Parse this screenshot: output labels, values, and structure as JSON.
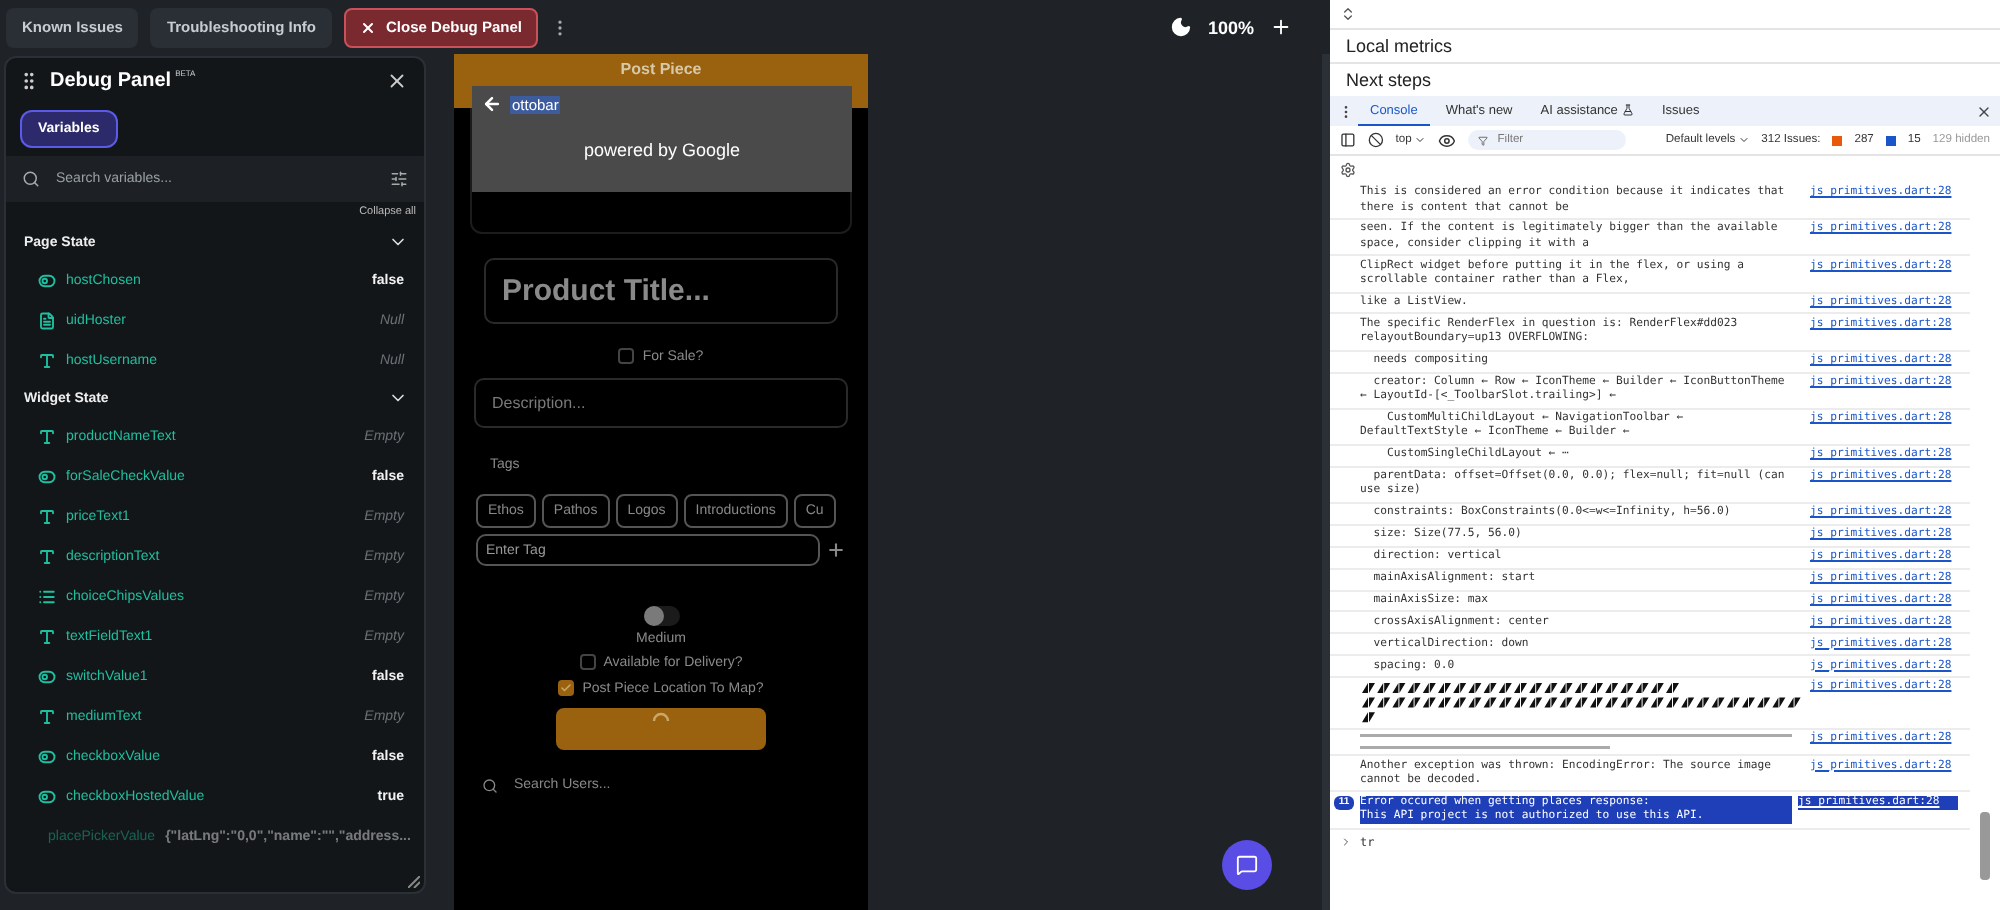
{
  "top_bar": {
    "buttons": [
      {
        "label": "Known Issues",
        "kind": "plain"
      },
      {
        "label": "Troubleshooting Info",
        "kind": "plain"
      },
      {
        "label": "Close Debug Panel",
        "kind": "danger"
      }
    ],
    "zoom": "100%"
  },
  "debug_panel": {
    "title": "Debug Panel",
    "badge": "BETA",
    "tabs": [
      {
        "label": "Variables",
        "selected": true
      }
    ],
    "search": {
      "placeholder": "Search variables..."
    },
    "collapse_all": "Collapse all",
    "sections": [
      {
        "title": "Page State",
        "expanded": true,
        "rows": [
          {
            "name": "hostChosen",
            "kind": "bool",
            "value": "false",
            "empty": false,
            "disabled": false
          },
          {
            "name": "uidHoster",
            "kind": "doc",
            "value": "Null",
            "empty": true,
            "disabled": false
          },
          {
            "name": "hostUsername",
            "kind": "text",
            "value": "Null",
            "empty": true,
            "disabled": false
          }
        ]
      },
      {
        "title": "Widget State",
        "expanded": true,
        "rows": [
          {
            "name": "productNameText",
            "kind": "text",
            "value": "Empty",
            "empty": true,
            "disabled": false
          },
          {
            "name": "forSaleCheckValue",
            "kind": "bool",
            "value": "false",
            "empty": false,
            "disabled": false
          },
          {
            "name": "priceText1",
            "kind": "text",
            "value": "Empty",
            "empty": true,
            "disabled": false
          },
          {
            "name": "descriptionText",
            "kind": "text",
            "value": "Empty",
            "empty": true,
            "disabled": false
          },
          {
            "name": "choiceChipsValues",
            "kind": "list",
            "value": "Empty",
            "empty": true,
            "disabled": false
          },
          {
            "name": "textFieldText1",
            "kind": "text",
            "value": "Empty",
            "empty": true,
            "disabled": false
          },
          {
            "name": "switchValue1",
            "kind": "bool",
            "value": "false",
            "empty": false,
            "disabled": false
          },
          {
            "name": "mediumText",
            "kind": "text",
            "value": "Empty",
            "empty": true,
            "disabled": false
          },
          {
            "name": "checkboxValue",
            "kind": "bool",
            "value": "false",
            "empty": false,
            "disabled": false
          },
          {
            "name": "checkboxHostedValue",
            "kind": "bool",
            "value": "true",
            "empty": false,
            "disabled": false
          },
          {
            "name": "placePickerValue",
            "kind": "place",
            "value": "{\"latLng\":\"0,0\",\"name\":\"\",\"address...",
            "empty": false,
            "disabled": true
          }
        ]
      }
    ]
  },
  "preview": {
    "title": "Post Piece",
    "place_search": {
      "value": "ottobar",
      "selected": true,
      "attribution": "powered by Google"
    },
    "product_title": {
      "placeholder": "Product Title..."
    },
    "for_sale": {
      "label": "For Sale?",
      "checked": false
    },
    "description": {
      "placeholder": "Description..."
    },
    "tags_label": "Tags",
    "tags": [
      "Ethos",
      "Pathos",
      "Logos",
      "Introductions",
      "Cu"
    ],
    "tag_input": {
      "placeholder": "Enter Tag"
    },
    "switch": {
      "on": false
    },
    "switch_label": "Medium",
    "delivery": {
      "label": "Available for Delivery?",
      "checked": false
    },
    "map": {
      "label": "Post Piece Location To Map?",
      "checked": true
    },
    "submit": {
      "loading": true
    },
    "user_search": {
      "placeholder": "Search Users..."
    }
  },
  "devtools": {
    "sections": [
      "Local metrics",
      "Next steps"
    ],
    "tabs": [
      {
        "label": "Console",
        "selected": true
      },
      {
        "label": "What's new",
        "selected": false
      },
      {
        "label": "AI assistance",
        "selected": false
      },
      {
        "label": "Issues",
        "selected": false
      }
    ],
    "toolbar": {
      "context": "top",
      "filter_placeholder": "Filter",
      "levels": "Default levels",
      "issues_label": "312 Issues:",
      "errors": "287",
      "infos": "15",
      "hidden": "129 hidden"
    },
    "messages": [
      {
        "kind": "log",
        "text": "This is considered an error condition because it indicates that there is content that cannot be",
        "source": "js_primitives.dart:28"
      },
      {
        "kind": "log",
        "text": "seen. If the content is legitimately bigger than the available space, consider clipping it with a",
        "source": "js_primitives.dart:28"
      },
      {
        "kind": "log",
        "text": "ClipRect widget before putting it in the flex, or using a scrollable container rather than a Flex,",
        "source": "js_primitives.dart:28"
      },
      {
        "kind": "log",
        "text": "like a ListView.",
        "source": "js_primitives.dart:28"
      },
      {
        "kind": "log",
        "text": "The specific RenderFlex in question is: RenderFlex#dd023 relayoutBoundary=up13 OVERFLOWING:",
        "source": "js_primitives.dart:28"
      },
      {
        "kind": "log",
        "text": "  needs compositing",
        "source": "js_primitives.dart:28"
      },
      {
        "kind": "log",
        "text": "  creator: Column ← Row ← IconTheme ← Builder ← IconButtonTheme ← LayoutId-[<_ToolbarSlot.trailing>] ←",
        "source": "js_primitives.dart:28"
      },
      {
        "kind": "log",
        "text": "    CustomMultiChildLayout ← NavigationToolbar ← DefaultTextStyle ← IconTheme ← Builder ←",
        "source": "js_primitives.dart:28"
      },
      {
        "kind": "log",
        "text": "    CustomSingleChildLayout ← ⋯",
        "source": "js_primitives.dart:28"
      },
      {
        "kind": "log",
        "text": "  parentData: offset=Offset(0.0, 0.0); flex=null; fit=null (can use size)",
        "source": "js_primitives.dart:28"
      },
      {
        "kind": "log",
        "text": "  constraints: BoxConstraints(0.0<=w<=Infinity, h=56.0)",
        "source": "js_primitives.dart:28"
      },
      {
        "kind": "log",
        "text": "  size: Size(77.5, 56.0)",
        "source": "js_primitives.dart:28"
      },
      {
        "kind": "log",
        "text": "  direction: vertical",
        "source": "js_primitives.dart:28"
      },
      {
        "kind": "log",
        "text": "  mainAxisAlignment: start",
        "source": "js_primitives.dart:28"
      },
      {
        "kind": "log",
        "text": "  mainAxisSize: max",
        "source": "js_primitives.dart:28"
      },
      {
        "kind": "log",
        "text": "  crossAxisAlignment: center",
        "source": "js_primitives.dart:28"
      },
      {
        "kind": "log",
        "text": "  verticalDirection: down",
        "source": "js_primitives.dart:28"
      },
      {
        "kind": "log",
        "text": "  spacing: 0.0",
        "source": "js_primitives.dart:28"
      },
      {
        "kind": "garble",
        "source": "js_primitives.dart:28"
      },
      {
        "kind": "rule",
        "source": "js_primitives.dart:28"
      },
      {
        "kind": "log",
        "text": "Another exception was thrown: EncodingError: The source image cannot be decoded.",
        "source": "js_primitives.dart:28"
      },
      {
        "kind": "error",
        "count": "11",
        "text": "Error occured when getting places response:\nThis API project is not authorized to use this API.",
        "source": "js_primitives.dart:28"
      }
    ],
    "prompt": "tr"
  }
}
